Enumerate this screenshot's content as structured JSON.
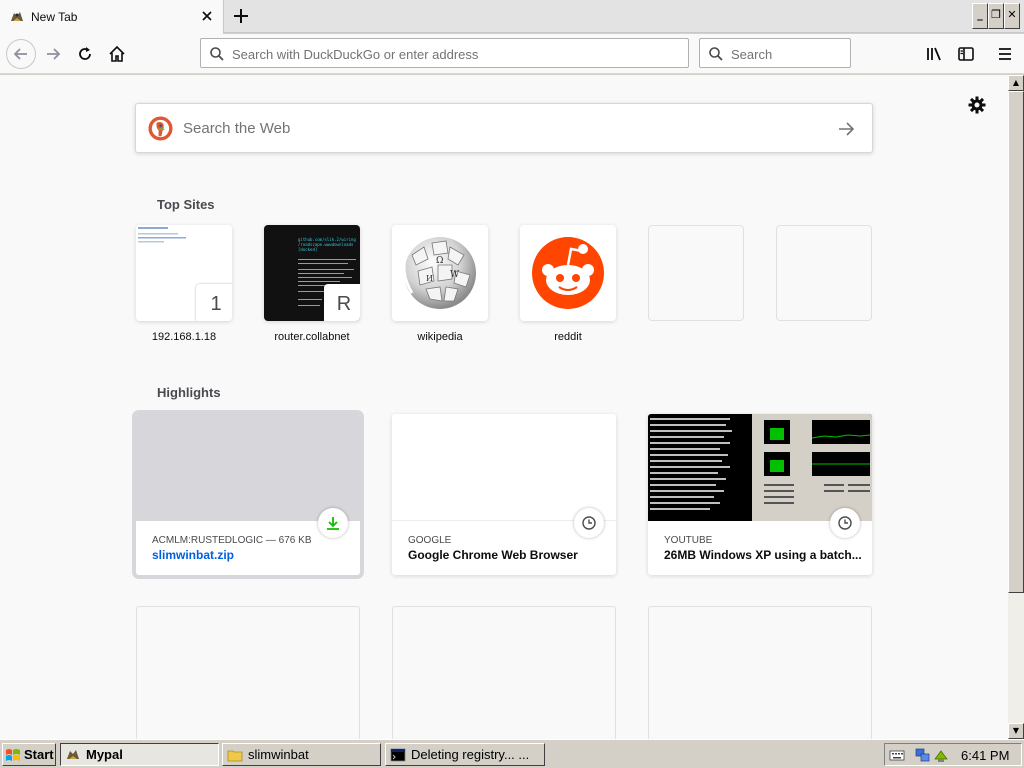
{
  "browser": {
    "tab_title": "New Tab",
    "url_placeholder": "Search with DuckDuckGo or enter address",
    "search_placeholder": "Search"
  },
  "newtab": {
    "web_search_placeholder": "Search the Web",
    "top_sites_title": "Top Sites",
    "top_sites": [
      {
        "label": "192.168.1.18",
        "letter": "1"
      },
      {
        "label": "router.collabnet",
        "letter": "R"
      },
      {
        "label": "wikipedia",
        "letter": ""
      },
      {
        "label": "reddit",
        "letter": ""
      }
    ],
    "highlights_title": "Highlights",
    "highlights": [
      {
        "host": "ACMLM:RUSTEDLOGIC — 676 KB",
        "title": "slimwinbat.zip",
        "badge_icon": "download-icon"
      },
      {
        "host": "GOOGLE",
        "title": "Google Chrome Web Browser",
        "badge_icon": "clock-icon"
      },
      {
        "host": "YOUTUBE",
        "title": "26MB Windows XP using a batch...",
        "badge_icon": "clock-icon"
      }
    ],
    "router_preview_text": [
      "github.com/slik.2/wiring",
      "/roadscape.wwwdownloads",
      "[docked]"
    ]
  },
  "taskbar": {
    "start_label": "Start",
    "items": [
      {
        "label": "Mypal",
        "active": true
      },
      {
        "label": "slimwinbat",
        "active": false
      },
      {
        "label": "Deleting registry... ...",
        "active": false
      }
    ],
    "clock": "6:41 PM"
  },
  "colors": {
    "download_green": "#12bc00",
    "link_blue": "#0060df",
    "reddit_orange": "#ff4500",
    "ddg_orange": "#de5833"
  }
}
